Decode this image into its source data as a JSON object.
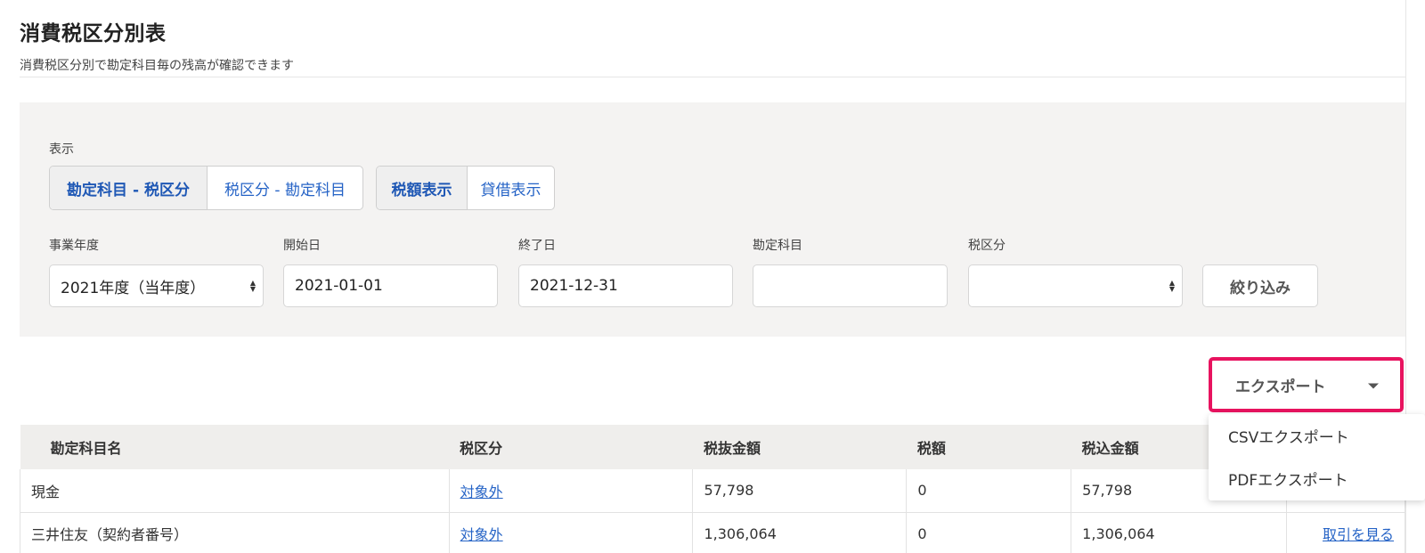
{
  "page": {
    "title": "消費税区分別表",
    "description": "消費税区分別で勘定科目毎の残高が確認できます"
  },
  "filters": {
    "display_label": "表示",
    "view_toggle": [
      "勘定科目 - 税区分",
      "税区分 - 勘定科目"
    ],
    "amount_toggle": [
      "税額表示",
      "貸借表示"
    ],
    "fiscal_year": {
      "label": "事業年度",
      "value": "2021年度（当年度）"
    },
    "start_date": {
      "label": "開始日",
      "value": "2021-01-01"
    },
    "end_date": {
      "label": "終了日",
      "value": "2021-12-31"
    },
    "account": {
      "label": "勘定科目",
      "value": ""
    },
    "tax_category": {
      "label": "税区分",
      "value": ""
    },
    "filter_button": "絞り込み"
  },
  "export": {
    "button_label": "エクスポート",
    "highlight_color": "#e8135f",
    "menu": [
      "CSVエクスポート",
      "PDFエクスポート"
    ]
  },
  "table": {
    "headers": [
      "勘定科目名",
      "税区分",
      "税抜金額",
      "税額",
      "税込金額",
      ""
    ],
    "rows": [
      {
        "account": "現金",
        "tax": "対象外",
        "excl": "57,798",
        "tax_amount": "0",
        "incl": "57,798",
        "action": ""
      },
      {
        "account": "三井住友（契約者番号）",
        "tax": "対象外",
        "excl": "1,306,064",
        "tax_amount": "0",
        "incl": "1,306,064",
        "action": "取引を見る"
      }
    ]
  },
  "colors": {
    "link": "#2563c6",
    "panel_bg": "#f4f3f2"
  }
}
